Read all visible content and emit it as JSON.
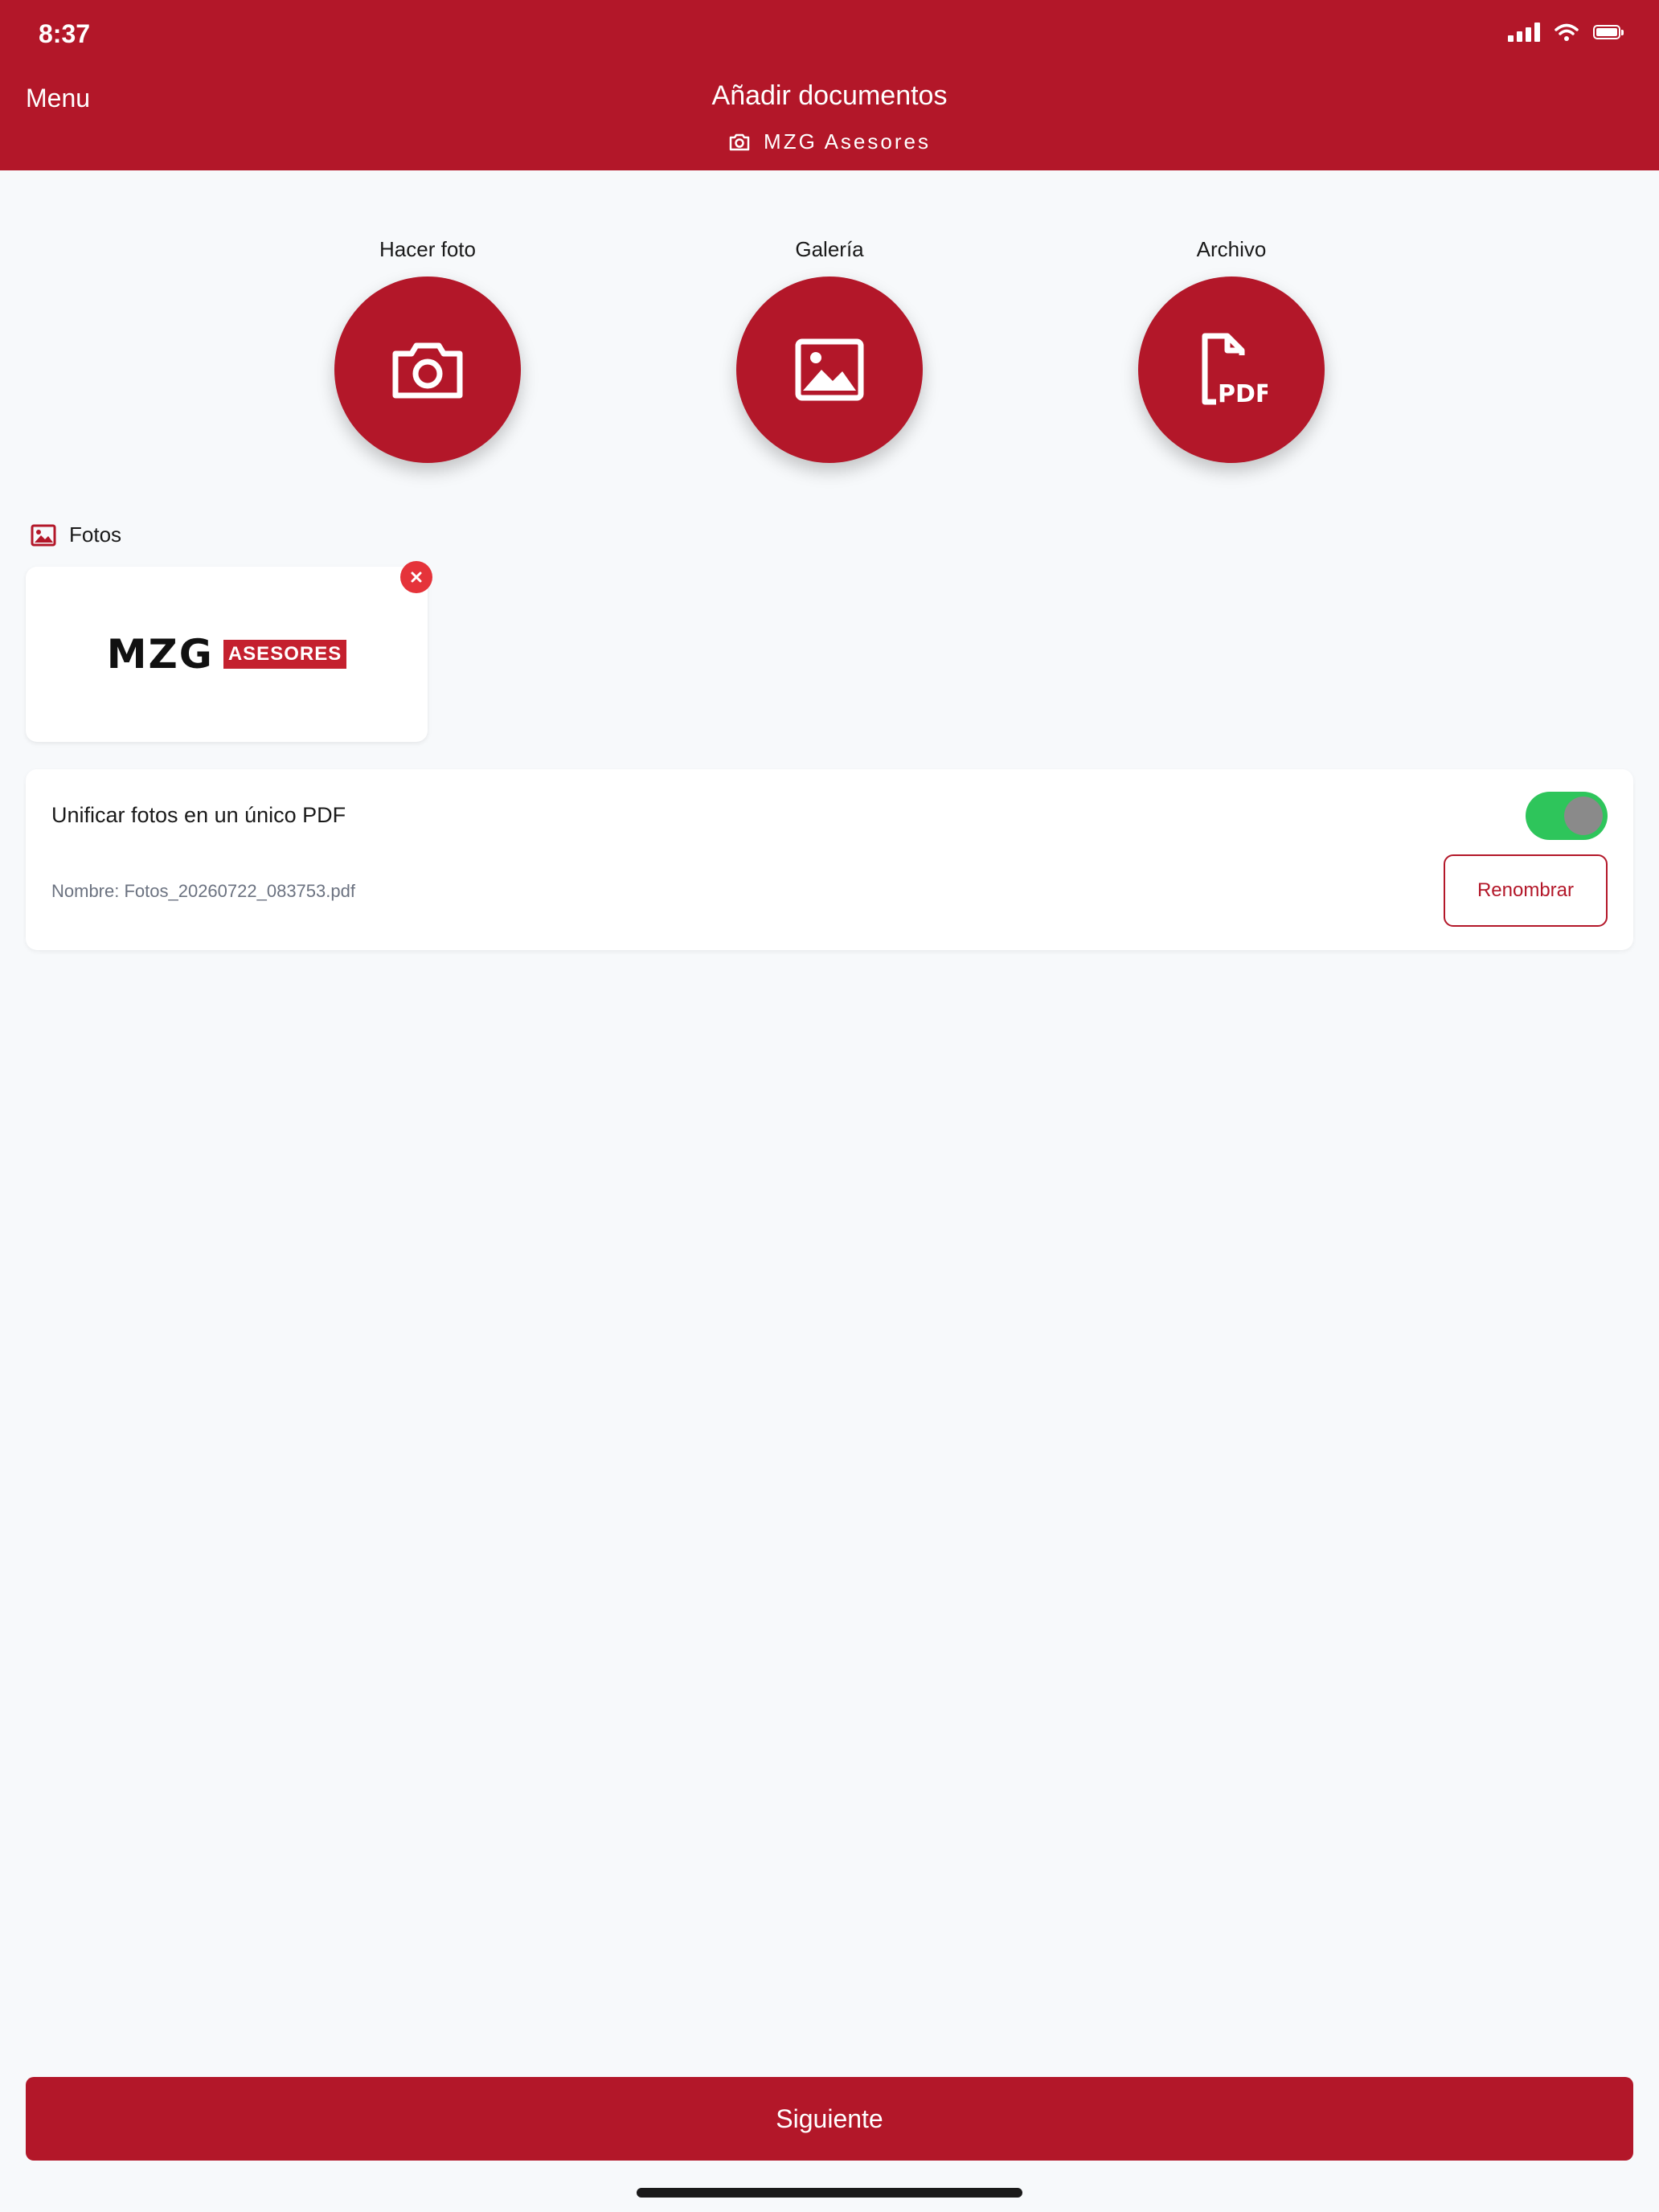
{
  "status_bar": {
    "time": "8:37"
  },
  "header": {
    "menu_label": "Menu",
    "title": "Añadir documentos",
    "subtitle": "MZG Asesores"
  },
  "actions": [
    {
      "label": "Hacer foto",
      "icon": "camera-icon"
    },
    {
      "label": "Galería",
      "icon": "image-icon"
    },
    {
      "label": "Archivo",
      "icon": "pdf-file-icon"
    }
  ],
  "photos_section": {
    "title": "Fotos",
    "thumbnail_logo": {
      "main": "MZG",
      "tag": "ASESORES"
    }
  },
  "options": {
    "unify_label": "Unificar fotos en un único PDF",
    "unify_enabled": true,
    "filename_text": "Nombre: Fotos_20260722_083753.pdf",
    "rename_label": "Renombrar"
  },
  "footer": {
    "next_label": "Siguiente"
  },
  "colors": {
    "brand": "#b31729",
    "toggle_on": "#2ec55b",
    "remove": "#e5333a"
  }
}
